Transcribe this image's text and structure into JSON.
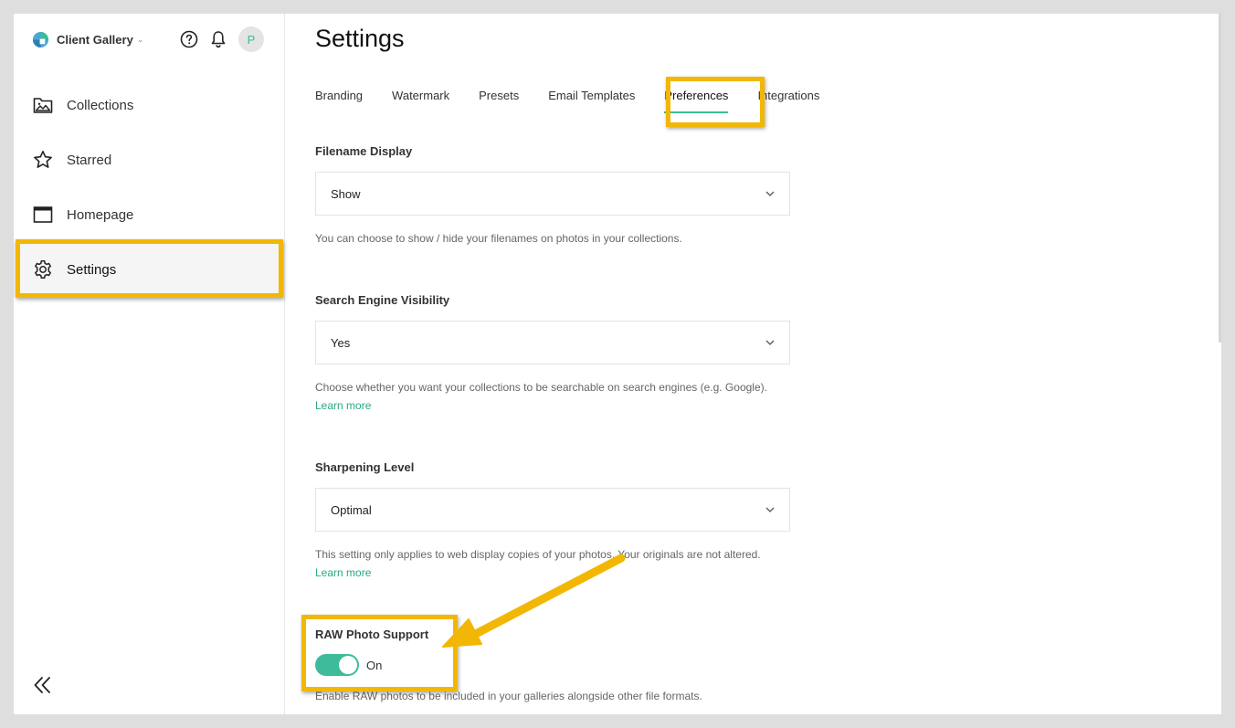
{
  "app": {
    "name": "Client Gallery",
    "avatar_initial": "P"
  },
  "icons": {
    "help": "help-circle-icon",
    "notifications": "bell-icon",
    "logo": "brand-logo-icon",
    "collapse": "double-chevron-left-icon"
  },
  "colors": {
    "accent": "#3dbb9a",
    "link": "#2aa785",
    "highlight": "#f2b705",
    "logo_blue": "#4aa7d6"
  },
  "sidebar": {
    "items": [
      {
        "label": "Collections",
        "icon": "image-folder-icon"
      },
      {
        "label": "Starred",
        "icon": "star-icon"
      },
      {
        "label": "Homepage",
        "icon": "browser-window-icon"
      },
      {
        "label": "Settings",
        "icon": "gear-icon",
        "active": true
      }
    ]
  },
  "page": {
    "title": "Settings",
    "tabs": [
      {
        "label": "Branding"
      },
      {
        "label": "Watermark"
      },
      {
        "label": "Presets"
      },
      {
        "label": "Email Templates"
      },
      {
        "label": "Preferences",
        "active": true
      },
      {
        "label": "Integrations"
      }
    ]
  },
  "preferences": {
    "filename_display": {
      "label": "Filename Display",
      "value": "Show",
      "help": "You can choose to show / hide your filenames on photos in your collections."
    },
    "search_visibility": {
      "label": "Search Engine Visibility",
      "value": "Yes",
      "help": "Choose whether you want your collections to be searchable on search engines (e.g. Google).",
      "link": "Learn more"
    },
    "sharpening": {
      "label": "Sharpening Level",
      "value": "Optimal",
      "help": "This setting only applies to web display copies of your photos. Your originals are not altered.",
      "link": "Learn more"
    },
    "raw_support": {
      "label": "RAW Photo Support",
      "state": "On",
      "enabled": true,
      "help": "Enable RAW photos to be included in your galleries alongside other file formats."
    }
  }
}
